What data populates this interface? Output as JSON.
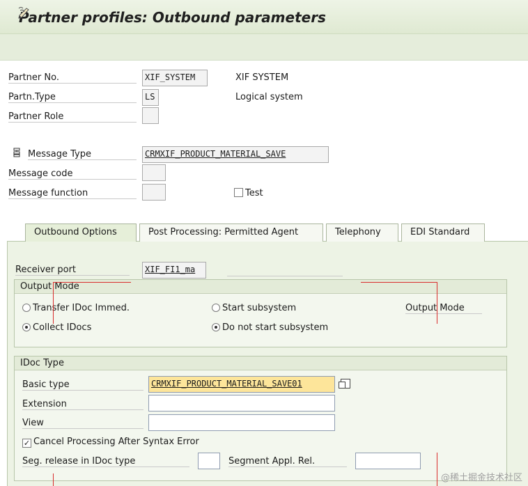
{
  "title": "Partner profiles: Outbound parameters",
  "toolbar": {
    "icon": "display-change-icon"
  },
  "header": {
    "partner_no_label": "Partner No.",
    "partner_no_value": "XIF_SYSTEM",
    "partner_no_desc": "XIF SYSTEM",
    "partn_type_label": "Partn.Type",
    "partn_type_value": "LS",
    "partn_type_desc": "Logical system",
    "partner_role_label": "Partner Role",
    "partner_role_value": "",
    "message_type_label": "Message Type",
    "message_type_value": "CRMXIF_PRODUCT_MATERIAL_SAVE",
    "message_code_label": "Message code",
    "message_code_value": "",
    "message_function_label": "Message function",
    "message_function_value": "",
    "test_label": "Test",
    "test_checked": false
  },
  "tabs": [
    {
      "label": "Outbound Options",
      "active": true
    },
    {
      "label": "Post Processing: Permitted Agent",
      "active": false
    },
    {
      "label": "Telephony",
      "active": false
    },
    {
      "label": "EDI Standard",
      "active": false
    }
  ],
  "outbound": {
    "receiver_port_label": "Receiver port",
    "receiver_port_value": "XIF_FI1_ma",
    "output_mode": {
      "title": "Output Mode",
      "transfer_idoc": "Transfer IDoc Immed.",
      "collect_idocs": "Collect IDocs",
      "start_subsystem": "Start subsystem",
      "do_not_start": "Do not start subsystem",
      "output_mode_label": "Output Mode",
      "selected_transfer": "collect",
      "selected_subsystem": "do_not_start"
    },
    "idoc_type": {
      "title": "IDoc Type",
      "basic_type_label": "Basic type",
      "basic_type_value": "CRMXIF_PRODUCT_MATERIAL_SAVE01",
      "extension_label": "Extension",
      "extension_value": "",
      "view_label": "View",
      "view_value": "",
      "cancel_label": "Cancel Processing After Syntax Error",
      "cancel_checked": true,
      "seg_release_label": "Seg. release in IDoc type",
      "seg_release_value": "",
      "segment_appl_label": "Segment Appl. Rel.",
      "segment_appl_value": ""
    }
  },
  "watermark": "@稀土掘金技术社区",
  "colors": {
    "annotation_line": "#d92b2b",
    "highlight_field": "#fde59a"
  }
}
